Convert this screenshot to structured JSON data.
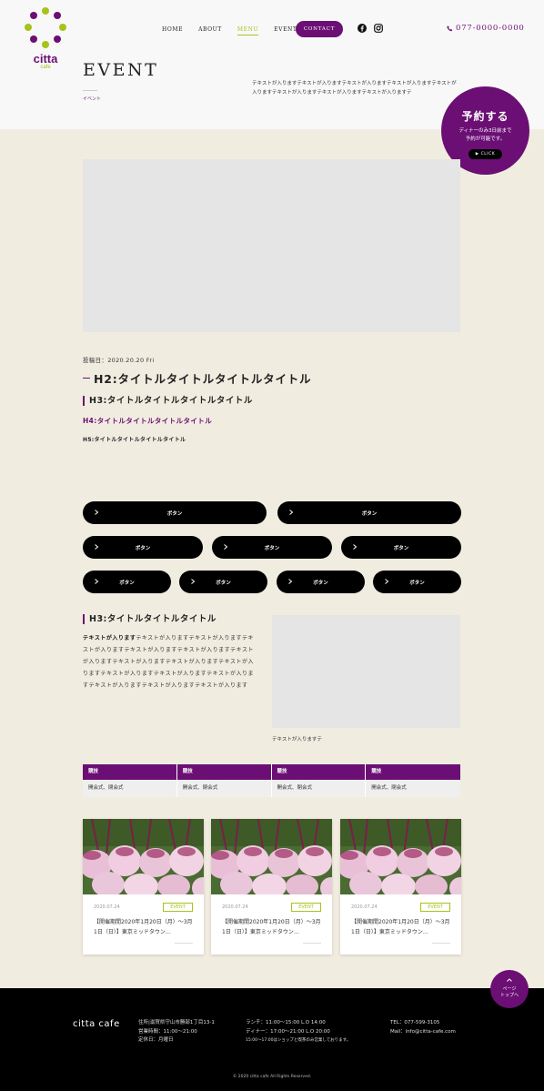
{
  "header": {
    "logo": {
      "word": "citta",
      "sub": "cafe",
      "dot_colors": [
        "#a6c21b",
        "#6b0f74"
      ]
    },
    "nav": [
      {
        "label": "HOME",
        "active": false
      },
      {
        "label": "ABOUT",
        "active": false
      },
      {
        "label": "MENU",
        "active": true
      },
      {
        "label": "EVENT",
        "active": false
      }
    ],
    "contact_label": "CONTACT",
    "social_icons": [
      "facebook-icon",
      "instagram-icon"
    ],
    "phone": "077-0000-0000"
  },
  "page": {
    "title": "EVENT",
    "subtitle": "イベント",
    "intro": "テキストが入りますテキストが入りますテキストが入りますテキストが入りますテキストが入りますテキストが入りますテキストが入りますテキストが入りますテ"
  },
  "reserve": {
    "title": "予約する",
    "line1": "ディナーのみ3日前まで",
    "line2": "予約が可能です。",
    "click": "CLICK"
  },
  "article": {
    "date": "投稿日：2020.20.20 Fri",
    "h2": "H2:タイトルタイトルタイトルタイトル",
    "h3": "H3:タイトルタイトルタイトルタイトル",
    "h4": "H4:タイトルタイトルタイトルタイトル",
    "h5": "H5:タイトルタイトルタイトルタイトル"
  },
  "buttons": {
    "row1": [
      "ボタン",
      "ボタン"
    ],
    "row2": [
      "ボタン",
      "ボタン",
      "ボタン"
    ],
    "row3": [
      "ボタン",
      "ボタン",
      "ボタン",
      "ボタン"
    ]
  },
  "section": {
    "h3": "H3:タイトルタイトルタイトル",
    "bold": "テキストが入ります",
    "text": "テキストが入りますテキストが入りますテキストが入りますテキストが入りますテキストが入りますテキストが入りますテキストが入りますテキストが入りますテキストが入りますテキストが入りますテキストが入りますテキストが入りますテキストが入りますテキストが入りますテキストが入ります",
    "caption": "テキストが入りますテ"
  },
  "table": {
    "headers": [
      "競技",
      "競技",
      "競技",
      "競技"
    ],
    "cells": [
      "開会式、閉会式",
      "開会式、閉会式",
      "開会式、閉会式",
      "開会式、閉会式"
    ]
  },
  "cards": [
    {
      "date": "2020.07.24",
      "tag": "EVENT",
      "title": "【開催期間2020年1月20日（月）〜3月1日（日）】東京ミッドタウン…"
    },
    {
      "date": "2020.07.24",
      "tag": "EVENT",
      "title": "【開催期間2020年1月20日（月）〜3月1日（日）】東京ミッドタウン…"
    },
    {
      "date": "2020.07.24",
      "tag": "EVENT",
      "title": "【開催期間2020年1月20日（月）〜3月1日（日）】東京ミッドタウン…"
    }
  ],
  "pagetop": {
    "line1": "ページ",
    "line2": "トップへ"
  },
  "footer": {
    "name": "citta cafe",
    "address": "住所|滋賀県守山市勝部1丁目13-1",
    "hours": "営業時間：11:00〜21:00",
    "holiday": "定休日：月曜日",
    "lunch": "ランチ：11:00〜15:00 L.O 14:00",
    "dinner": "ディナー：17:00〜21:00 L.O 20:00",
    "note": "15:00〜17:00はショップと喫茶のみ営業しております。",
    "tel": "TEL：077-599-3105",
    "mail": "Mail：info@citta-cafe.com",
    "copyright": "© 2020 citta cafe All Rights Reserved."
  }
}
